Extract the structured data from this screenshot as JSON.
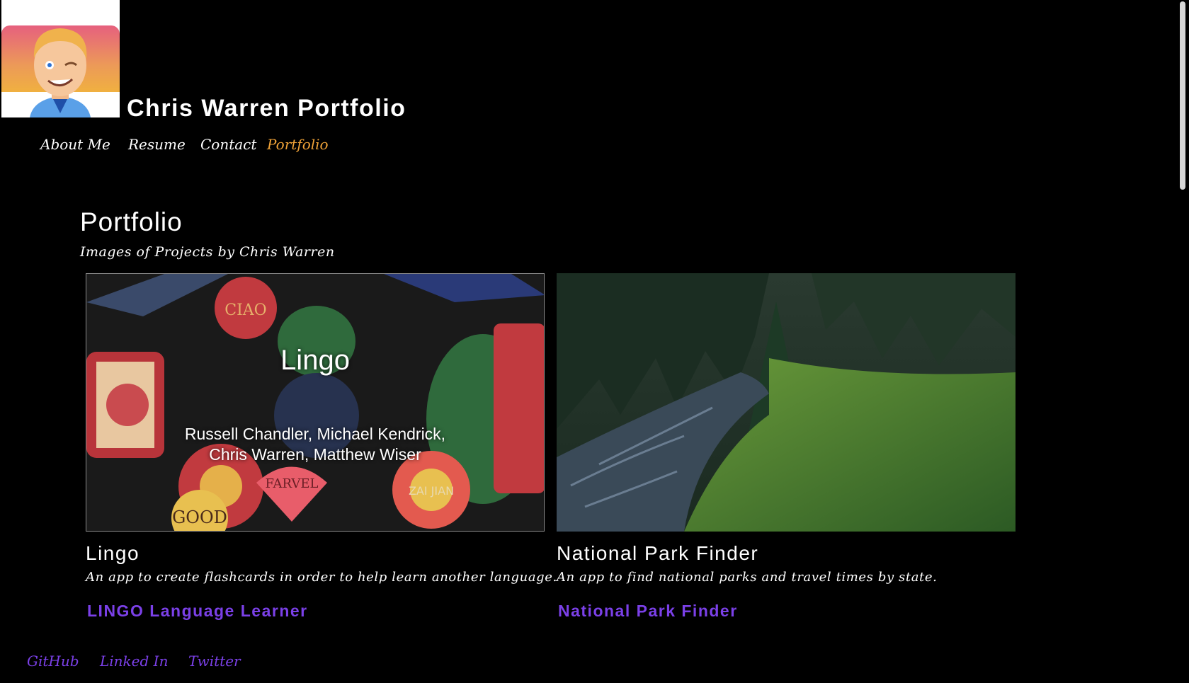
{
  "header": {
    "site_title": "Chris Warren Portfolio",
    "avatar": "cartoon-avatar-winking"
  },
  "nav": {
    "items": [
      {
        "label": "About Me",
        "active": false
      },
      {
        "label": "Resume",
        "active": false
      },
      {
        "label": "Contact",
        "active": false
      },
      {
        "label": "Portfolio",
        "active": true
      }
    ],
    "active_color": "#f0a338"
  },
  "main": {
    "heading": "Portfolio",
    "subheading": "Images of Projects by Chris Warren",
    "projects": [
      {
        "image_title": "Lingo",
        "image_names": "Russell Chandler, Michael Kendrick,\nChris Warren, Matthew Wiser",
        "image_words": [
          "CIAO",
          "FARVEL",
          "GOOD",
          "ZAI JIAN"
        ],
        "title": "Lingo",
        "description": "An app to create flashcards in order to help learn another language.",
        "link_label": "LINGO Language Learner"
      },
      {
        "image": "forest-river-photo",
        "title": "National Park Finder",
        "description": "An app to find national parks and travel times by state.",
        "link_label": "National Park Finder"
      }
    ],
    "link_color": "#7b40e8"
  },
  "footer": {
    "links": [
      "GitHub",
      "Linked In",
      "Twitter"
    ]
  }
}
